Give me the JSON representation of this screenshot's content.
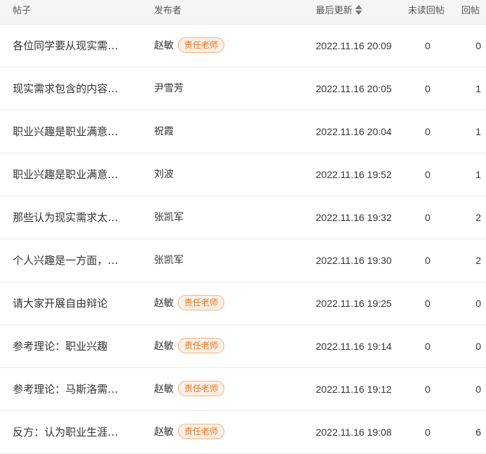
{
  "header": {
    "title": "帖子",
    "author": "发布者",
    "last_update": "最后更新",
    "unread": "未读回帖",
    "replies": "回帖"
  },
  "colors": {
    "badge_text": "#e8731a",
    "badge_border": "#f5b07a",
    "badge_bg": "#fdf0e6",
    "header_bg": "#f5f5f5"
  },
  "icons": {
    "sort": "sort-icon"
  },
  "rows": [
    {
      "title": "各位同学要从现实需…",
      "author": "赵敏",
      "badge": "责任老师",
      "time": "2022.11.16 20:09",
      "unread": "0",
      "replies": "0"
    },
    {
      "title": "现实需求包含的内容…",
      "author": "尹雪芳",
      "badge": "",
      "time": "2022.11.16 20:05",
      "unread": "0",
      "replies": "1"
    },
    {
      "title": "职业兴趣是职业满意…",
      "author": "祝霞",
      "badge": "",
      "time": "2022.11.16 20:04",
      "unread": "0",
      "replies": "1"
    },
    {
      "title": "职业兴趣是职业满意…",
      "author": "刘波",
      "badge": "",
      "time": "2022.11.16 19:52",
      "unread": "0",
      "replies": "1"
    },
    {
      "title": "那些认为现实需求太…",
      "author": "张凯军",
      "badge": "",
      "time": "2022.11.16 19:32",
      "unread": "0",
      "replies": "2"
    },
    {
      "title": "个人兴趣是一方面，…",
      "author": "张凯军",
      "badge": "",
      "time": "2022.11.16 19:30",
      "unread": "0",
      "replies": "2"
    },
    {
      "title": "请大家开展自由辩论",
      "author": "赵敏",
      "badge": "责任老师",
      "time": "2022.11.16 19:25",
      "unread": "0",
      "replies": "0"
    },
    {
      "title": "参考理论：职业兴趣",
      "author": "赵敏",
      "badge": "责任老师",
      "time": "2022.11.16 19:14",
      "unread": "0",
      "replies": "0"
    },
    {
      "title": "参考理论：马斯洛需…",
      "author": "赵敏",
      "badge": "责任老师",
      "time": "2022.11.16 19:12",
      "unread": "0",
      "replies": "0"
    },
    {
      "title": "反方：认为职业生涯…",
      "author": "赵敏",
      "badge": "责任老师",
      "time": "2022.11.16 19:08",
      "unread": "0",
      "replies": "6"
    }
  ]
}
